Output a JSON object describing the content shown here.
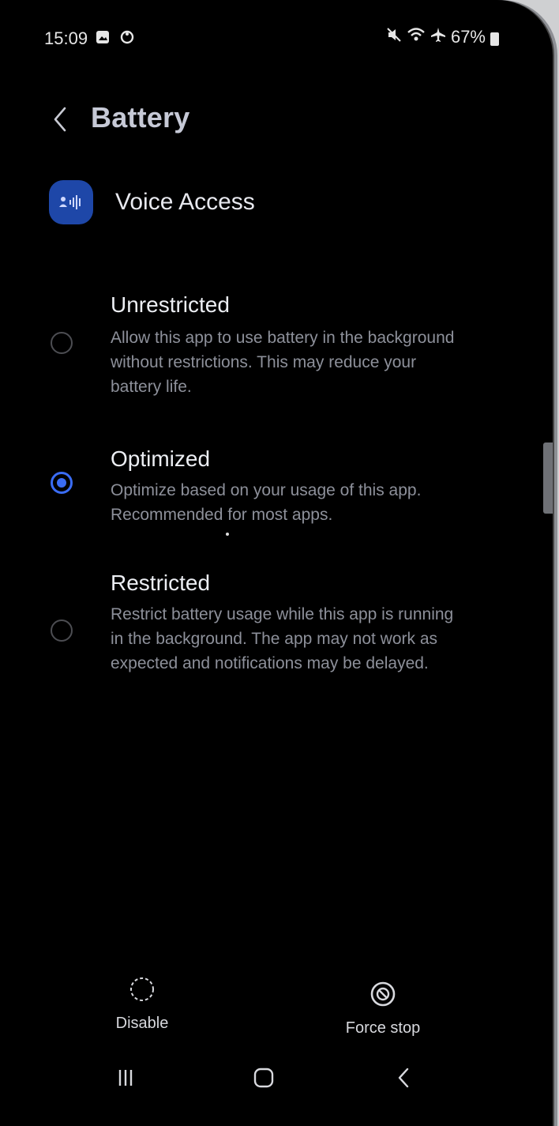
{
  "status_bar": {
    "time": "15:09",
    "battery": "67%",
    "icons": [
      "gallery-icon",
      "sync-icon",
      "mute-icon",
      "wifi-icon",
      "airplane-icon",
      "battery-icon"
    ]
  },
  "header": {
    "title": "Battery"
  },
  "app": {
    "name": "Voice Access",
    "icon": "voice-access-icon",
    "icon_color": "#1e47a8"
  },
  "options": [
    {
      "title": "Unrestricted",
      "description": "Allow this app to use battery in the background without restrictions. This may reduce your battery life.",
      "selected": false
    },
    {
      "title": "Optimized",
      "description": "Optimize based on your usage of this app. Recommended for most apps.",
      "selected": true
    },
    {
      "title": "Restricted",
      "description": "Restrict battery usage while this app is running in the background. The app may not work as expected and notifications may be delayed.",
      "selected": false
    }
  ],
  "bottom_actions": {
    "disable_label": "Disable",
    "force_stop_label": "Force stop"
  },
  "nav": {
    "recents": "recents-icon",
    "home": "home-icon",
    "back": "back-icon"
  },
  "colors": {
    "accent": "#3a6cf4",
    "background": "#000000"
  }
}
